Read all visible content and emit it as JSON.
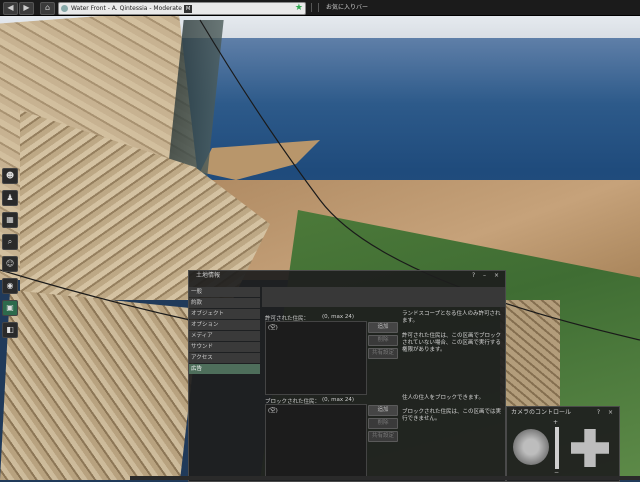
{
  "topbar": {
    "back_icon": "back-arrow-icon",
    "forward_icon": "forward-arrow-icon",
    "home_icon": "home-icon",
    "location": "Water Front - A. Qintessia - Moderate",
    "maturity_badge": "M",
    "favorites_label": "お気に入りバー"
  },
  "left_toolbar": {
    "items": [
      {
        "icon": "people-icon",
        "glyph": "👥"
      },
      {
        "icon": "appearance-icon",
        "glyph": "👕"
      },
      {
        "icon": "inventory-icon",
        "glyph": "▦"
      },
      {
        "icon": "search-icon",
        "glyph": "🔍"
      },
      {
        "icon": "speak-icon",
        "glyph": "☺"
      },
      {
        "icon": "destinations-icon",
        "glyph": "◉"
      },
      {
        "icon": "camera-icon",
        "glyph": "▣"
      },
      {
        "icon": "map-icon",
        "glyph": "◧"
      }
    ]
  },
  "about_land": {
    "title": "土地情報",
    "controls": "? – ×",
    "tabs": [
      "一般",
      "約款",
      "オブジェクト",
      "オプション",
      "メディア",
      "サウンド",
      "アクセス",
      "広告"
    ],
    "selected_tab": "広告",
    "allowed": {
      "label": "許可された住民：",
      "count": "(0, max 24)",
      "items": [
        "(空)"
      ],
      "add": "追加",
      "remove": "削除",
      "share": "共有設定",
      "help_1": "ランドスコープとなる住人のみ許可されます。",
      "help_2": "許可された住民は、この区画でブロックされていない場合、この区画で実行する権限があります。"
    },
    "banned": {
      "label": "ブロックされた住民：",
      "count": "(0, max 24)",
      "items": [
        "(空)"
      ],
      "add": "追加",
      "remove": "削除",
      "share": "共有設定",
      "help_1": "住人の住人をブロックできます。",
      "help_2": "ブロックされた住民は、この区画では実行できません。"
    }
  },
  "camera_controls": {
    "title": "カメラのコントロール",
    "controls": "? ×",
    "zoom_plus": "+",
    "zoom_minus": "−"
  },
  "colors": {
    "selected_tab": "#4e6e5b",
    "favorite_star": "#2fa84f",
    "panel_bg": "#1e1e1e"
  }
}
